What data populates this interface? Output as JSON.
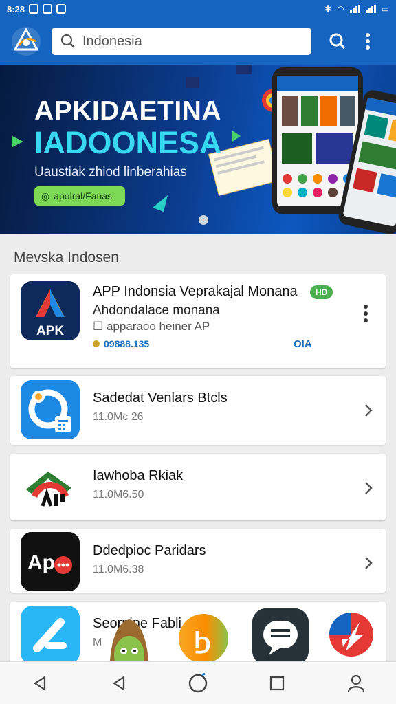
{
  "status_bar": {
    "time": "8:28"
  },
  "search": {
    "value": "Indonesia"
  },
  "banner": {
    "title_line1": "APKIDAETINA",
    "title_line2": "IADOONESA",
    "subtitle": "Uaustiak zhiod linberahias",
    "cta_label": "apolral/Fanas"
  },
  "section_title": "Mevska Indosen",
  "featured": {
    "title": "APP Indonsia Veprakajal Monana",
    "badge": "HD",
    "line2": "Ahdondalace monana",
    "line3": "apparaoo heiner AP",
    "rating": "09888.135",
    "action": "OIA",
    "icon_text": "APK"
  },
  "apps": [
    {
      "name": "Sadedat Venlars Btcls",
      "meta": "11.0Mc 26"
    },
    {
      "name": "Iawhoba Rkiak",
      "meta": "11.0M6.50"
    },
    {
      "name": "Ddedpioc Paridars",
      "meta": "11.0M6.38"
    }
  ],
  "partial_app": {
    "name": "Seorpine Fabli",
    "meta": "M"
  },
  "colors": {
    "primary": "#1565c0",
    "accent": "#38d8f0",
    "cta": "#7ed957",
    "link": "#1a6fbf"
  }
}
